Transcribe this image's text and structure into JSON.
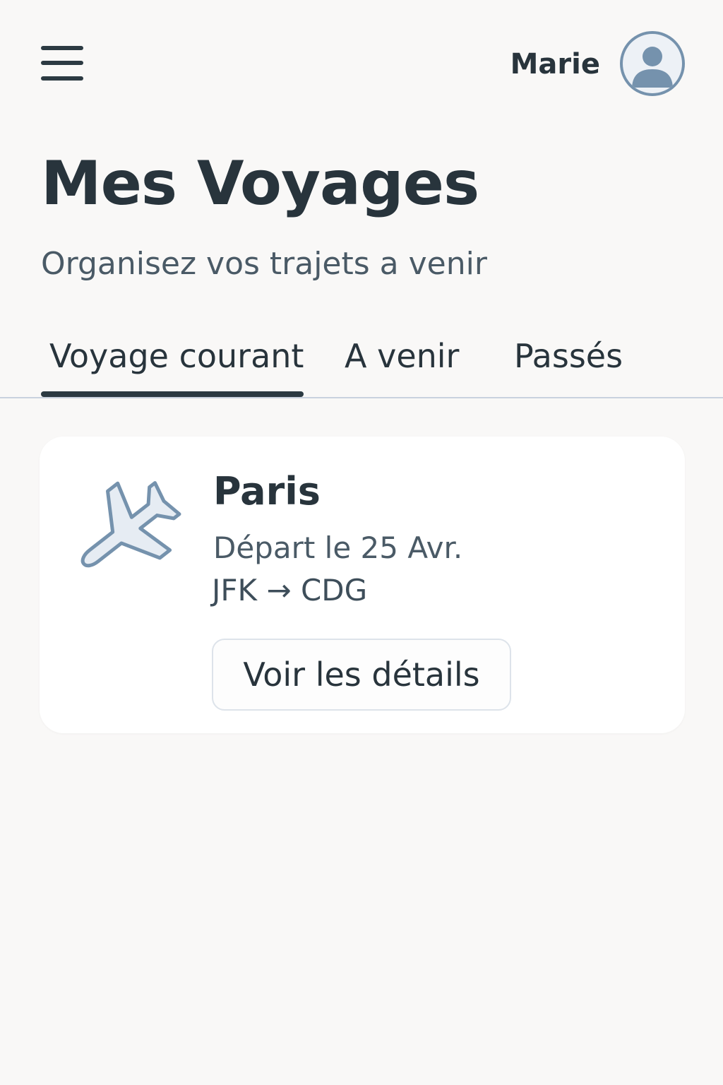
{
  "header": {
    "menu_icon": "hamburger-menu-icon",
    "user_name": "Marie",
    "avatar_icon": "user-avatar-icon"
  },
  "page": {
    "title": "Mes Voyages",
    "subtitle": "Organisez vos trajets a venir"
  },
  "tabs": [
    {
      "label": "Voyage courant",
      "active": true
    },
    {
      "label": "A venir",
      "active": false
    },
    {
      "label": "Passés",
      "active": false
    }
  ],
  "trip": {
    "icon": "airplane-icon",
    "city": "Paris",
    "departure": "Départ le 25 Avr.",
    "route": "JFK → CDG",
    "details_label": "Voir les détails"
  },
  "colors": {
    "background": "#f9f8f7",
    "text_primary": "#28343c",
    "text_secondary": "#4a5a66",
    "accent": "#7592ad",
    "icon_fill": "#e6ecf3"
  }
}
